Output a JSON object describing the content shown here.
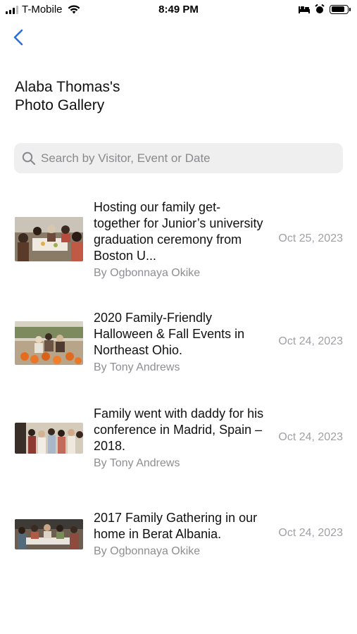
{
  "status_bar": {
    "carrier": "T-Mobile",
    "time": "8:49 PM",
    "battery_level": 0.85
  },
  "nav": {
    "back_icon": "chevron-left-icon",
    "accent_color": "#2d6fd6"
  },
  "header": {
    "title_line1": "Alaba Thomas's",
    "title_line2": "Photo Gallery"
  },
  "search": {
    "placeholder": "Search by Visitor, Event or Date",
    "value": ""
  },
  "gallery": {
    "items": [
      {
        "title": "Hosting our family get-together for Junior’s university graduation ceremony from Boston U...",
        "author": "By Ogbonnaya Okike",
        "date": "Oct 25, 2023",
        "thumbnail": "family-dinner-photo"
      },
      {
        "title": "2020 Family-Friendly Halloween & Fall Events in Northeast Ohio.",
        "author": "By Tony Andrews",
        "date": "Oct 24, 2023",
        "thumbnail": "pumpkin-patch-photo"
      },
      {
        "title": "Family went with daddy for his conference in Madrid, Spain – 2018.",
        "author": "By Tony Andrews",
        "date": "Oct 24, 2023",
        "thumbnail": "family-group-photo"
      },
      {
        "title": "2017 Family Gathering in our home in Berat Albania.",
        "author": "By Ogbonnaya Okike",
        "date": "Oct 24, 2023",
        "thumbnail": "family-gathering-photo"
      }
    ]
  }
}
